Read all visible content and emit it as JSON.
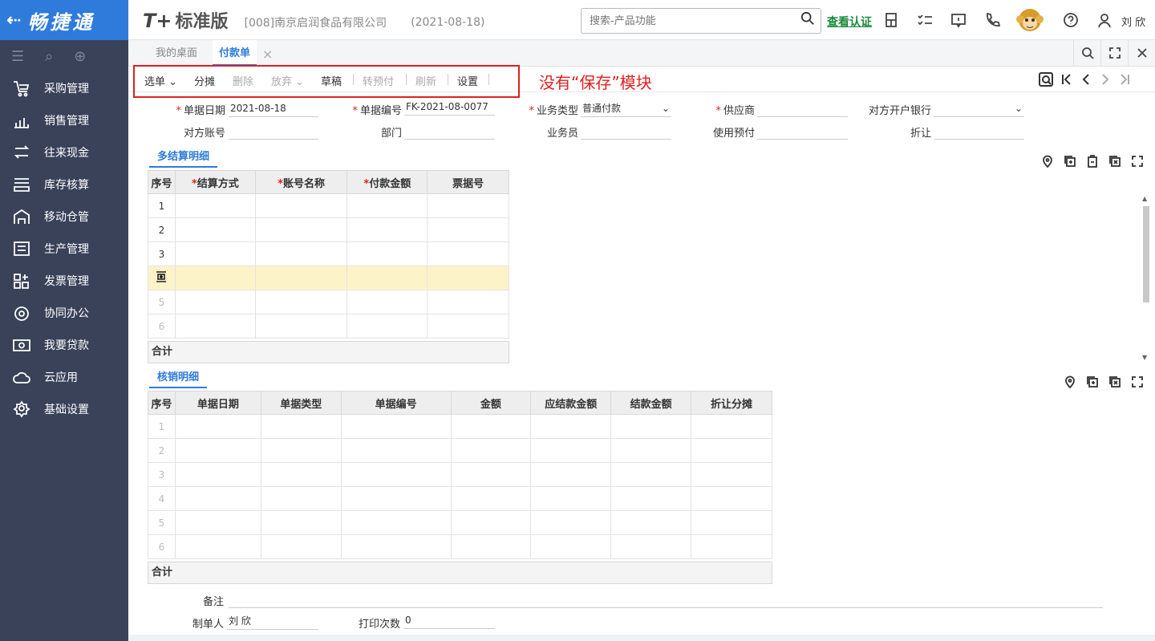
{
  "brand": {
    "back_glyph": "⇠",
    "name": "畅捷通"
  },
  "sidebar": {
    "items": [
      {
        "label": "采购管理",
        "icon": "cart-icon"
      },
      {
        "label": "销售管理",
        "icon": "chart-icon"
      },
      {
        "label": "往来现金",
        "icon": "exchange-icon"
      },
      {
        "label": "库存核算",
        "icon": "inventory-icon"
      },
      {
        "label": "移动仓管",
        "icon": "mobile-warehouse-icon"
      },
      {
        "label": "生产管理",
        "icon": "production-icon"
      },
      {
        "label": "发票管理",
        "icon": "invoice-icon"
      },
      {
        "label": "协同办公",
        "icon": "collaboration-icon"
      },
      {
        "label": "我要贷款",
        "icon": "loan-icon"
      },
      {
        "label": "云应用",
        "icon": "cloud-icon"
      },
      {
        "label": "基础设置",
        "icon": "settings-icon"
      }
    ]
  },
  "header": {
    "product_tplus": "T+",
    "product_name": "标准版",
    "company": "[008]南京启润食品有限公司",
    "date": "(2021-08-18)",
    "search_placeholder": "搜索-产品功能",
    "verify_link": "查看认证",
    "user": "刘 欣"
  },
  "tabs": {
    "desktop": "我的桌面",
    "active": "付款单",
    "close_glyph": "×"
  },
  "toolbar": {
    "select": "选单",
    "split": "分摊",
    "delete": "删除",
    "discard": "放弃",
    "draft": "草稿",
    "to_prepay": "转预付",
    "refresh": "刷新",
    "settings": "设置",
    "annotation": "没有“保存”模块"
  },
  "form": {
    "doc_date_label": "单据日期",
    "doc_date": "2021-08-18",
    "doc_no_label": "单据编号",
    "doc_no": "FK-2021-08-0077",
    "biz_type_label": "业务类型",
    "biz_type": "普通付款",
    "supplier_label": "供应商",
    "supplier": "",
    "bank_label": "对方开户银行",
    "bank": "",
    "account_label": "对方账号",
    "dept_label": "部门",
    "staff_label": "业务员",
    "prepay_label": "使用预付",
    "discount_label": "折让"
  },
  "settlement": {
    "title": "多结算明细",
    "columns": [
      "序号",
      "结算方式",
      "账号名称",
      "付款金额",
      "票据号"
    ],
    "rows": [
      "1",
      "2",
      "3",
      "",
      "5",
      "6"
    ],
    "total": "合计"
  },
  "writeoff": {
    "title": "核销明细",
    "columns": [
      "序号",
      "单据日期",
      "单据类型",
      "单据编号",
      "金额",
      "应结款金额",
      "结款金额",
      "折让分摊"
    ],
    "rows": [
      "1",
      "2",
      "3",
      "4",
      "5",
      "6"
    ],
    "total": "合计"
  },
  "footer": {
    "remark_label": "备注",
    "maker_label": "制单人",
    "maker": "刘 欣",
    "print_count_label": "打印次数",
    "print_count": "0"
  },
  "colors": {
    "brand_blue": "#2f7bdb",
    "sidebar_bg": "#394258",
    "annotation_red": "#e02020",
    "highlight_row": "#fdf3c9"
  }
}
